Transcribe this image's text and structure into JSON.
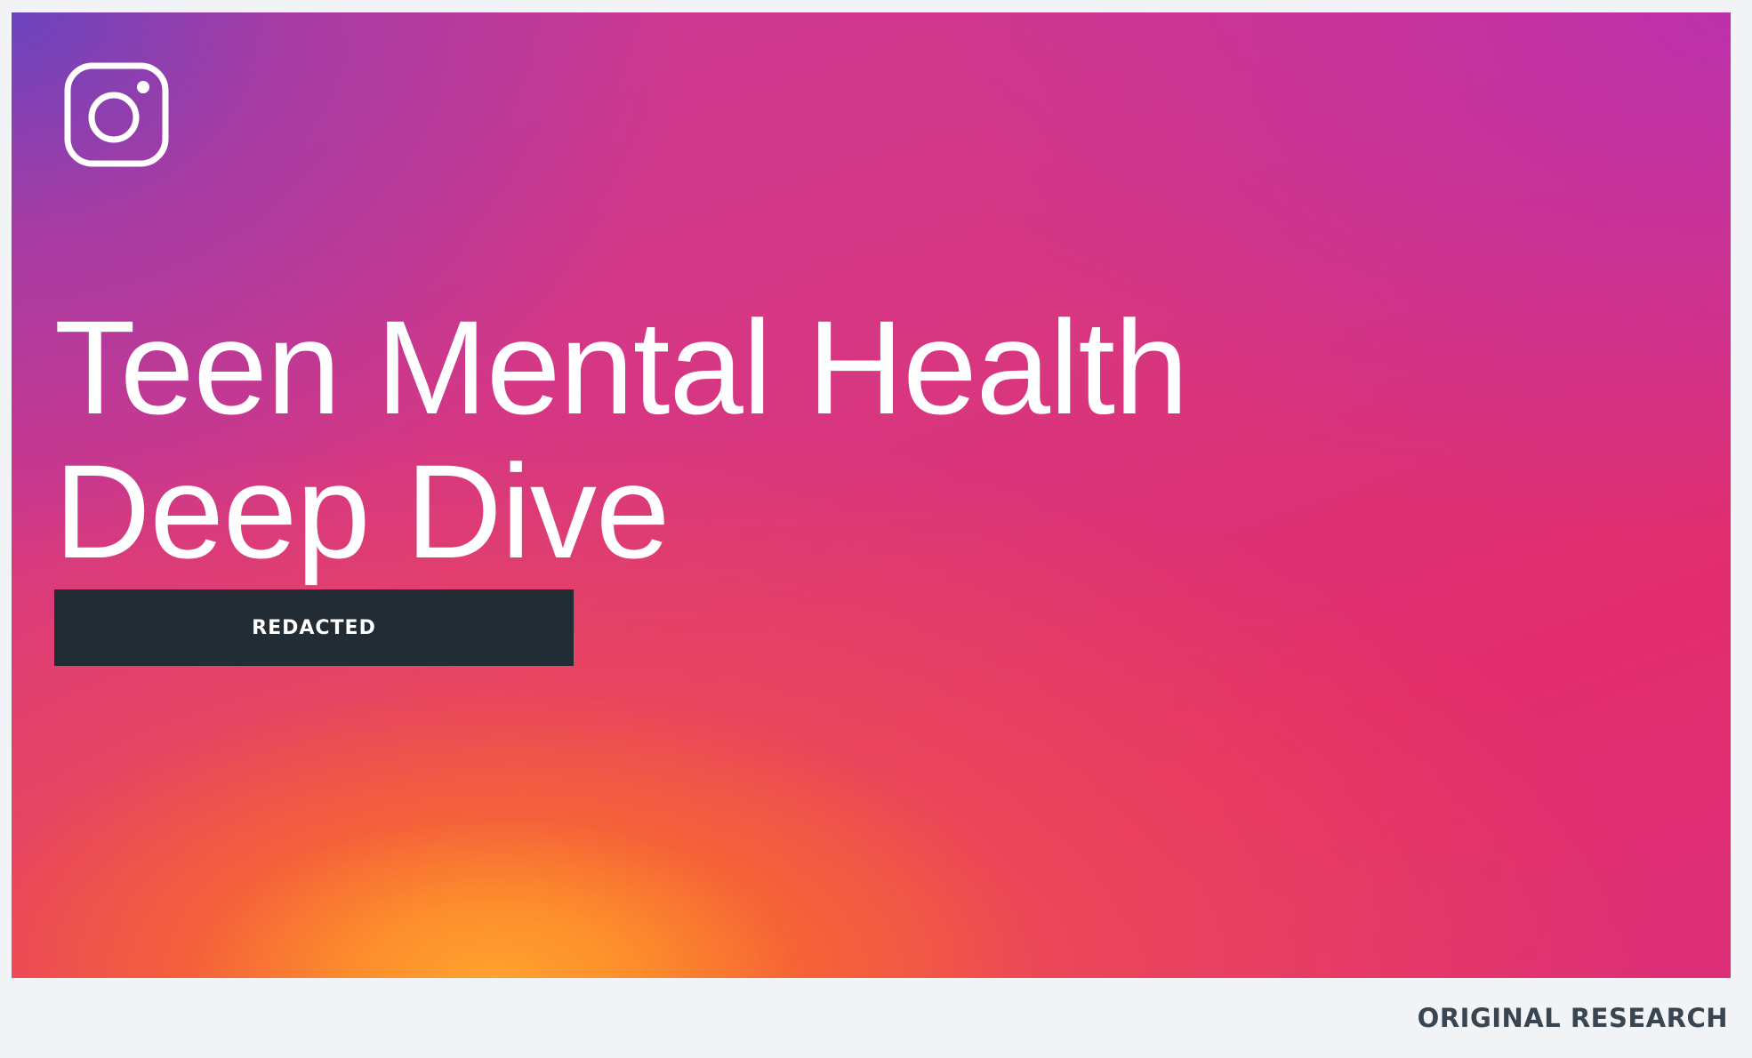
{
  "slide": {
    "logo_icon": "instagram-icon",
    "title_lines": [
      "Teen Mental Health",
      "Deep Dive"
    ],
    "redacted_label": "REDACTED"
  },
  "footer": {
    "label": "ORIGINAL RESEARCH"
  },
  "colors": {
    "gradient_purple": "#6c44be",
    "gradient_pink": "#e22d6c",
    "gradient_orange": "#ffa22f",
    "redacted_bar": "#212c34",
    "footer_text": "#3a4552",
    "page_background": "#f2f3f6"
  }
}
